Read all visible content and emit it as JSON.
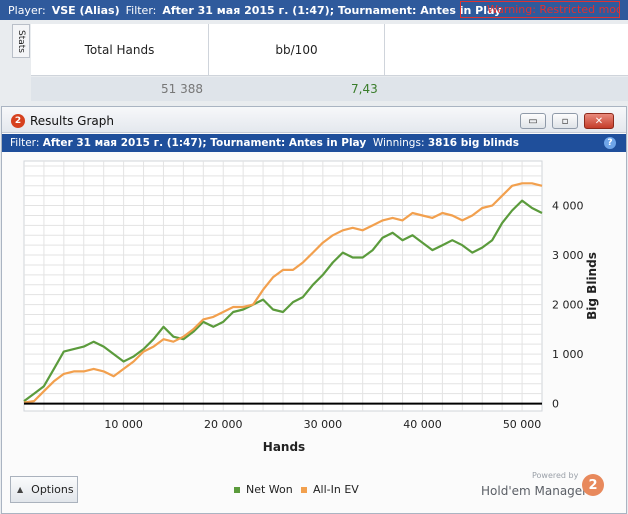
{
  "topbar": {
    "player_label": "Player:",
    "player_value": "VSE (Alias)",
    "filter_label": "Filter:",
    "filter_value": "After 31 мая 2015 г. (1:47); Tournament: Antes in Play",
    "warning": "Warning: Restricted mode"
  },
  "stats": {
    "tab_label": "Stats",
    "columns": [
      "Total Hands",
      "bb/100"
    ],
    "values": [
      "51 388",
      "7,43"
    ]
  },
  "window": {
    "badge": "2",
    "title": "Results Graph",
    "buttons": {
      "minimize": "▭",
      "restore": "▫",
      "close": "✕"
    },
    "filter_label": "Filter:",
    "filter_value": "After 31 мая 2015 г. (1:47); Tournament: Antes in Play",
    "winnings_label": "Winnings:",
    "winnings_value": "3816 big blinds",
    "help": "?"
  },
  "footer": {
    "options_label": "Options",
    "powered_by": "Powered by",
    "brand": "Hold'em Manager",
    "brand_logo": "2"
  },
  "colors": {
    "net_won": "#5b9b3c",
    "all_in_ev": "#f2a04e",
    "zero_line": "#000000",
    "grid": "#e3e3e3"
  },
  "chart_data": {
    "type": "line",
    "xlabel": "Hands",
    "ylabel": "Big Blinds",
    "xlim": [
      0,
      52000
    ],
    "ylim": [
      -150,
      4900
    ],
    "xticks": [
      10000,
      20000,
      30000,
      40000,
      50000
    ],
    "xtick_labels": [
      "10 000",
      "20 000",
      "30 000",
      "40 000",
      "50 000"
    ],
    "yticks": [
      0,
      1000,
      2000,
      3000,
      4000
    ],
    "ytick_labels": [
      "0",
      "1 000",
      "2 000",
      "3 000",
      "4 000"
    ],
    "grid": true,
    "legend_position": "bottom",
    "series": [
      {
        "name": "Net Won",
        "x": [
          0,
          1000,
          2000,
          3000,
          4000,
          5000,
          6000,
          7000,
          8000,
          9000,
          10000,
          11000,
          12000,
          13000,
          14000,
          15000,
          16000,
          17000,
          18000,
          19000,
          20000,
          21000,
          22000,
          23000,
          24000,
          25000,
          26000,
          27000,
          28000,
          29000,
          30000,
          31000,
          32000,
          33000,
          34000,
          35000,
          36000,
          37000,
          38000,
          39000,
          40000,
          41000,
          42000,
          43000,
          44000,
          45000,
          46000,
          47000,
          48000,
          49000,
          50000,
          51000,
          52000
        ],
        "y": [
          50,
          200,
          350,
          700,
          1050,
          1100,
          1150,
          1250,
          1150,
          1000,
          850,
          950,
          1100,
          1300,
          1550,
          1350,
          1300,
          1450,
          1650,
          1550,
          1650,
          1850,
          1900,
          2000,
          2100,
          1900,
          1850,
          2050,
          2150,
          2400,
          2600,
          2850,
          3050,
          2950,
          2950,
          3100,
          3350,
          3450,
          3300,
          3400,
          3250,
          3100,
          3200,
          3300,
          3200,
          3050,
          3150,
          3300,
          3650,
          3900,
          4100,
          3950,
          3850
        ]
      },
      {
        "name": "All-In EV",
        "x": [
          0,
          1000,
          2000,
          3000,
          4000,
          5000,
          6000,
          7000,
          8000,
          9000,
          10000,
          11000,
          12000,
          13000,
          14000,
          15000,
          16000,
          17000,
          18000,
          19000,
          20000,
          21000,
          22000,
          23000,
          24000,
          25000,
          26000,
          27000,
          28000,
          29000,
          30000,
          31000,
          32000,
          33000,
          34000,
          35000,
          36000,
          37000,
          38000,
          39000,
          40000,
          41000,
          42000,
          43000,
          44000,
          45000,
          46000,
          47000,
          48000,
          49000,
          50000,
          51000,
          52000
        ],
        "y": [
          20,
          50,
          250,
          450,
          600,
          650,
          650,
          700,
          650,
          550,
          700,
          850,
          1050,
          1150,
          1300,
          1250,
          1350,
          1500,
          1700,
          1750,
          1850,
          1950,
          1950,
          2000,
          2300,
          2550,
          2700,
          2700,
          2850,
          3050,
          3250,
          3400,
          3500,
          3550,
          3500,
          3600,
          3700,
          3750,
          3700,
          3850,
          3800,
          3750,
          3850,
          3800,
          3700,
          3800,
          3950,
          4000,
          4200,
          4400,
          4450,
          4450,
          4400
        ]
      }
    ]
  }
}
